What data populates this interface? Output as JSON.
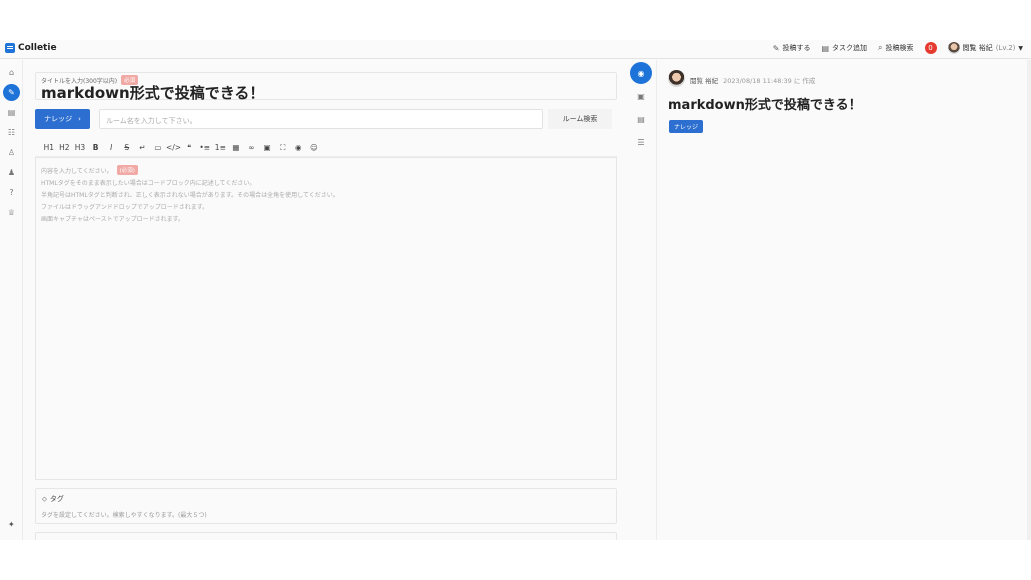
{
  "header": {
    "app_name": "Colletie",
    "nav": [
      {
        "icon": "edit-icon",
        "label": "投稿する"
      },
      {
        "icon": "task-icon",
        "label": "タスク追加"
      },
      {
        "icon": "search-icon",
        "label": "投稿検索"
      }
    ],
    "notification_count": "0",
    "user_name": "閲覧 裕紀",
    "user_level": "(Lv.2)"
  },
  "rail": {
    "icons": [
      "home-icon",
      "edit-icon",
      "document-icon",
      "group-icon",
      "user-icon",
      "users-icon",
      "help-icon",
      "trophy-icon"
    ],
    "active": "edit-icon",
    "pin_icon": "pin-icon"
  },
  "editor": {
    "title_label": "タイトルを入力(300字以内)",
    "required_badge": "必須",
    "title_value": "markdown形式で投稿できる！",
    "kind_button": "ナレッジ",
    "room_placeholder": "ルーム名を入力して下さい。",
    "room_search": "ルーム検索",
    "toolbar": [
      "H1",
      "H2",
      "H3",
      "B",
      "I",
      "S",
      "↵",
      "▭",
      "</>",
      "❝",
      "•≡",
      "1≡",
      "▦",
      "∞",
      "▣",
      "⛶",
      "◉",
      "☺"
    ],
    "content_placeholder": "内容を入力してください。",
    "content_required": "(必須)",
    "hints": [
      "HTMLタグをそのまま表示したい場合はコードブロック内に記述してください。",
      "半角記号はHTMLタグと判断され、正しく表示されない場合があります。その場合は全角を使用してください。",
      "ファイルはドラッグアンドドロップでアップロードされます。",
      "画面キャプチャはペーストでアップロードされます。"
    ],
    "tag_label": "タグ",
    "tag_placeholder": "タグを設定してください。検索しやすくなります。(最大５つ)"
  },
  "preview_rail": {
    "icons": [
      "eye-icon",
      "image-icon",
      "document-icon",
      "list-icon"
    ],
    "active": "eye-icon"
  },
  "preview": {
    "author": "閲覧 裕紀",
    "date": "2023/08/18 11:48:39 に 作成",
    "title": "markdown形式で投稿できる！",
    "tag": "ナレッジ"
  },
  "colors": {
    "accent": "#1e73d8",
    "required": "#f0a9a5",
    "notification": "#e53a2f"
  }
}
